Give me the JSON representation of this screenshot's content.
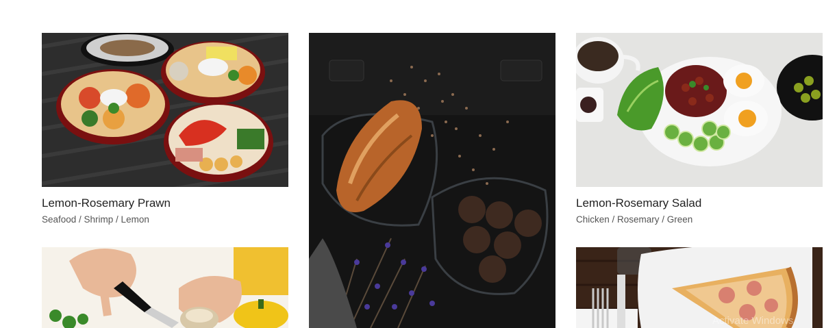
{
  "gallery": {
    "cards": [
      {
        "title": "Lemon-Rosemary Prawn",
        "tags": "Seafood / Shrimp / Lemon",
        "image_icon": "seafood-platter-image"
      },
      {
        "title": "",
        "tags": "",
        "image_icon": "croissant-and-meatballs-image"
      },
      {
        "title": "Lemon-Rosemary Salad",
        "tags": "Chicken / Rosemary / Green",
        "image_icon": "salad-with-eggs-image"
      },
      {
        "title": "",
        "tags": "",
        "image_icon": "chopping-mushrooms-image"
      },
      {
        "title": "",
        "tags": "",
        "image_icon": "pizza-slice-image"
      }
    ]
  },
  "overlay": {
    "watermark": "Activate Windows"
  },
  "colors": {
    "title_text": "#222222",
    "tag_text": "#555555",
    "background": "#ffffff"
  }
}
